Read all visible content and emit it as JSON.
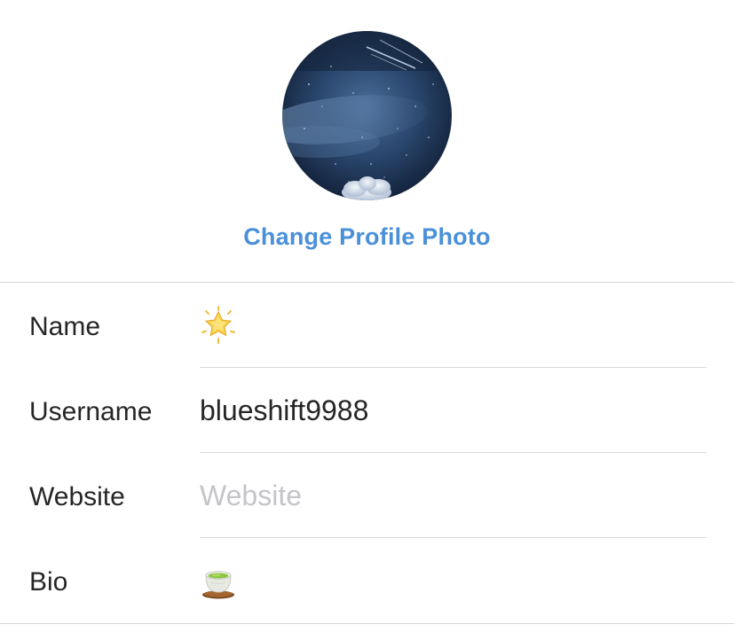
{
  "profile": {
    "change_photo_label": "Change Profile Photo",
    "accent_color": "#4a90d9",
    "avatar_icon": "night-sky-avatar"
  },
  "fields": {
    "name": {
      "label": "Name",
      "value_icon": "glowing-star-emoji"
    },
    "username": {
      "label": "Username",
      "value": "blueshift9988"
    },
    "website": {
      "label": "Website",
      "placeholder": "Website"
    },
    "bio": {
      "label": "Bio",
      "value_icon": "green-tea-emoji"
    }
  }
}
